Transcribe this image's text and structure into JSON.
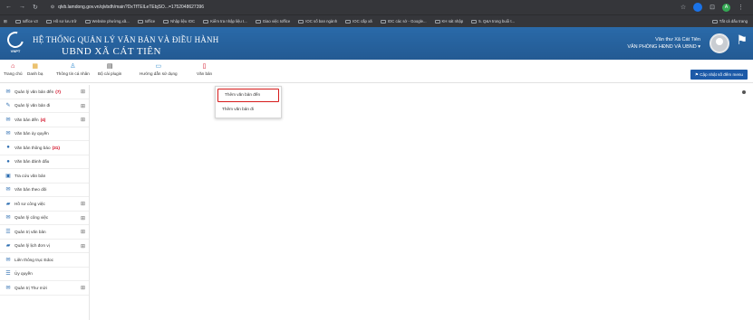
{
  "browser": {
    "url": "qlvb.lamdong.gov.vn/qlvbdh/main?DxTfTElLeTEbjSO...=1752048627396",
    "bookmarks": [
      "Ioffice v3",
      "Hồ sơ lưu trữ",
      "Website phường,xã...",
      "Ioffice",
      "Nhập liệu IOC",
      "Kiểm tra nhập liệu I...",
      "Giao việc Ioffice",
      "IOC số ban ngành",
      "IOC cấp xã",
      "IOC các sở - Google...",
      "KH sát nhập",
      "5. Q&A trong buổi t..."
    ],
    "all_bookmarks": "Tất cả dấu trang"
  },
  "header": {
    "logo_text": "VNPT",
    "title_line1": "HỆ THỐNG QUẢN LÝ VĂN BẢN VÀ ĐIỀU HÀNH",
    "title_line2": "UBND XÃ CÁT TIÊN",
    "user_line1": "Văn thư Xã Cát Tiên",
    "user_line2": "VĂN PHÒNG HĐND VÀ UBND ▾"
  },
  "toolbar": {
    "items": [
      "Trang chủ",
      "Danh bạ",
      "Thông tin cá nhân",
      "Bộ cài plugin",
      "Hướng dẫn sử dụng",
      "Văn bản"
    ],
    "update_button": "Cập nhật số đếm menu"
  },
  "sidebar": {
    "items": [
      {
        "label": "Quản lý văn bản đến",
        "count": "(7)",
        "icon": "inbox-icon",
        "expandable": true
      },
      {
        "label": "Quản lý văn bản đi",
        "count": "",
        "icon": "edit-icon",
        "expandable": true
      },
      {
        "label": "Văn bản đến",
        "count": "(4)",
        "icon": "inbox-icon",
        "expandable": true
      },
      {
        "label": "Văn bản ủy quyền",
        "count": "",
        "icon": "inbox-icon",
        "expandable": false
      },
      {
        "label": "Văn bản thông báo",
        "count": "(31)",
        "icon": "info-icon",
        "expandable": false
      },
      {
        "label": "Văn bản đánh dấu",
        "count": "",
        "icon": "info-icon",
        "expandable": false
      },
      {
        "label": "Tra cứu văn bản",
        "count": "",
        "icon": "image-icon",
        "expandable": false
      },
      {
        "label": "Văn bản theo dõi",
        "count": "",
        "icon": "inbox-icon",
        "expandable": false
      },
      {
        "label": "Hồ sơ công việc",
        "count": "",
        "icon": "book-icon",
        "expandable": true
      },
      {
        "label": "Quản lý công việc",
        "count": "",
        "icon": "inbox-icon",
        "expandable": true
      },
      {
        "label": "Quản trị văn bản",
        "count": "",
        "icon": "list-icon",
        "expandable": true
      },
      {
        "label": "Quản lý lịch đơn vị",
        "count": "",
        "icon": "book-icon",
        "expandable": true
      },
      {
        "label": "Liên thông trục Edoc",
        "count": "",
        "icon": "inbox-icon",
        "expandable": false
      },
      {
        "label": "Ủy quyền",
        "count": "",
        "icon": "list-icon",
        "expandable": false
      },
      {
        "label": "Quản trị Thư mời",
        "count": "",
        "icon": "inbox-icon",
        "expandable": true
      }
    ]
  },
  "dropdown": {
    "items": [
      "Thêm văn bản đến",
      "Thêm văn bản đi"
    ]
  }
}
